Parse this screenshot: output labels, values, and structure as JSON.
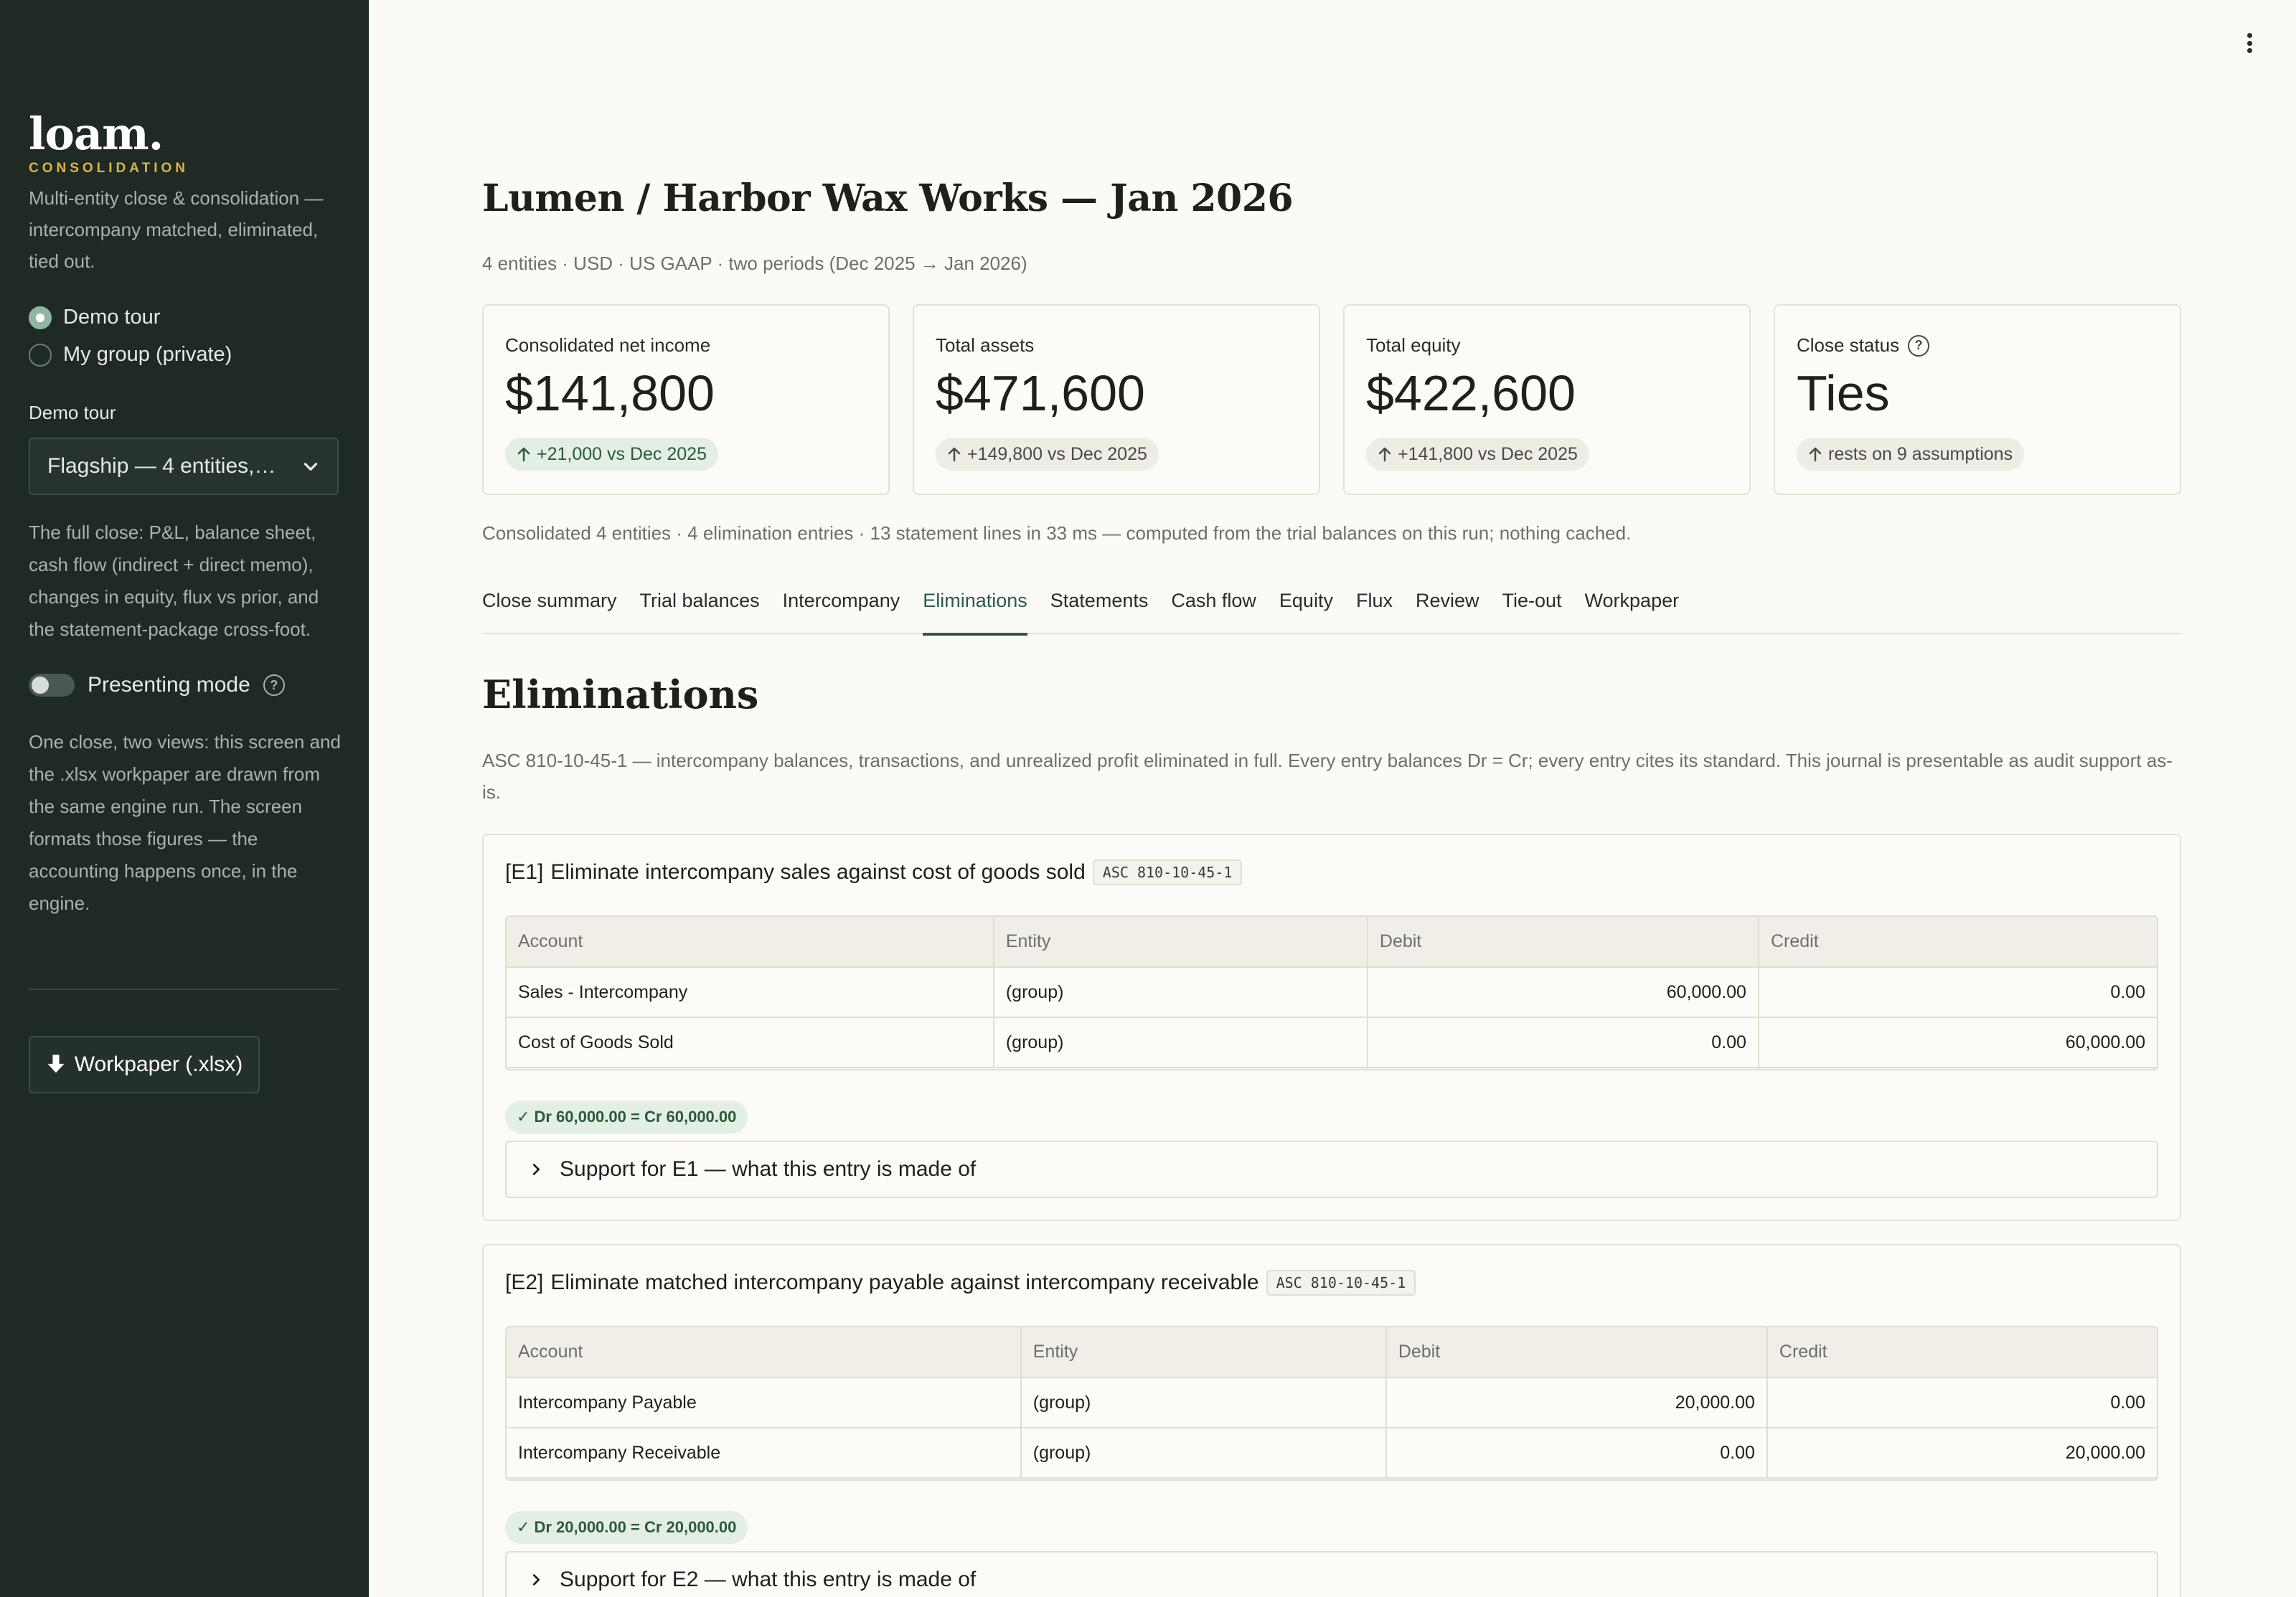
{
  "sidebar": {
    "logo": "loam.",
    "logo_sub": "CONSOLIDATION",
    "tagline": "Multi-entity close & consolidation — intercompany matched, eliminated, tied out.",
    "modes": [
      {
        "label": "Demo tour",
        "selected": true
      },
      {
        "label": "My group (private)",
        "selected": false
      }
    ],
    "tour_label": "Demo tour",
    "tour_select": "Flagship — 4 entities,…",
    "tour_description": "The full close: P&L, balance sheet, cash flow (indirect + direct memo), changes in equity, flux vs prior, and the statement-package cross-foot.",
    "presenting_label": "Presenting mode",
    "presenting_on": false,
    "engine_note": "One close, two views: this screen and the .xlsx workpaper are drawn from the same engine run. The screen formats those figures — the accounting happens once, in the engine.",
    "download_label": "Workpaper (.xlsx)"
  },
  "header": {
    "title": "Lumen / Harbor Wax Works — Jan 2026",
    "subtitle": "4 entities · USD · US GAAP · two periods (Dec 2025 → Jan 2026)"
  },
  "kpis": [
    {
      "label": "Consolidated net income",
      "value": "$141,800",
      "delta": "+21,000 vs Dec 2025",
      "tone": "pos",
      "help": false
    },
    {
      "label": "Total assets",
      "value": "$471,600",
      "delta": "+149,800 vs Dec 2025",
      "tone": "neutral",
      "help": false
    },
    {
      "label": "Total equity",
      "value": "$422,600",
      "delta": "+141,800 vs Dec 2025",
      "tone": "neutral",
      "help": false
    },
    {
      "label": "Close status",
      "value": "Ties",
      "delta": "rests on 9 assumptions",
      "tone": "neutral",
      "help": true
    }
  ],
  "run_note": "Consolidated 4 entities · 4 elimination entries · 13 statement lines in 33 ms — computed from the trial balances on this run; nothing cached.",
  "tabs": [
    {
      "label": "Close summary",
      "active": false
    },
    {
      "label": "Trial balances",
      "active": false
    },
    {
      "label": "Intercompany",
      "active": false
    },
    {
      "label": "Eliminations",
      "active": true
    },
    {
      "label": "Statements",
      "active": false
    },
    {
      "label": "Cash flow",
      "active": false
    },
    {
      "label": "Equity",
      "active": false
    },
    {
      "label": "Flux",
      "active": false
    },
    {
      "label": "Review",
      "active": false
    },
    {
      "label": "Tie-out",
      "active": false
    },
    {
      "label": "Workpaper",
      "active": false
    }
  ],
  "section": {
    "title": "Eliminations",
    "description": "ASC 810-10-45-1 — intercompany balances, transactions, and unrealized profit eliminated in full. Every entry balances Dr = Cr; every entry cites its standard. This journal is presentable as audit support as-is."
  },
  "columns": [
    "Account",
    "Entity",
    "Debit",
    "Credit"
  ],
  "entries": [
    {
      "id": "[E1]",
      "title": "Eliminate intercompany sales against cost of goods sold",
      "standard": "ASC 810-10-45-1",
      "rows": [
        {
          "account": "Sales - Intercompany",
          "entity": "(group)",
          "debit": "60,000.00",
          "credit": "0.00"
        },
        {
          "account": "Cost of Goods Sold",
          "entity": "(group)",
          "debit": "0.00",
          "credit": "60,000.00"
        }
      ],
      "balance": "Dr 60,000.00 = Cr 60,000.00",
      "support": "Support for E1 — what this entry is made of"
    },
    {
      "id": "[E2]",
      "title": "Eliminate matched intercompany payable against intercompany receivable",
      "standard": "ASC 810-10-45-1",
      "rows": [
        {
          "account": "Intercompany Payable",
          "entity": "(group)",
          "debit": "20,000.00",
          "credit": "0.00"
        },
        {
          "account": "Intercompany Receivable",
          "entity": "(group)",
          "debit": "0.00",
          "credit": "20,000.00"
        }
      ],
      "balance": "Dr 20,000.00 = Cr 20,000.00",
      "support": "Support for E2 — what this entry is made of"
    }
  ]
}
